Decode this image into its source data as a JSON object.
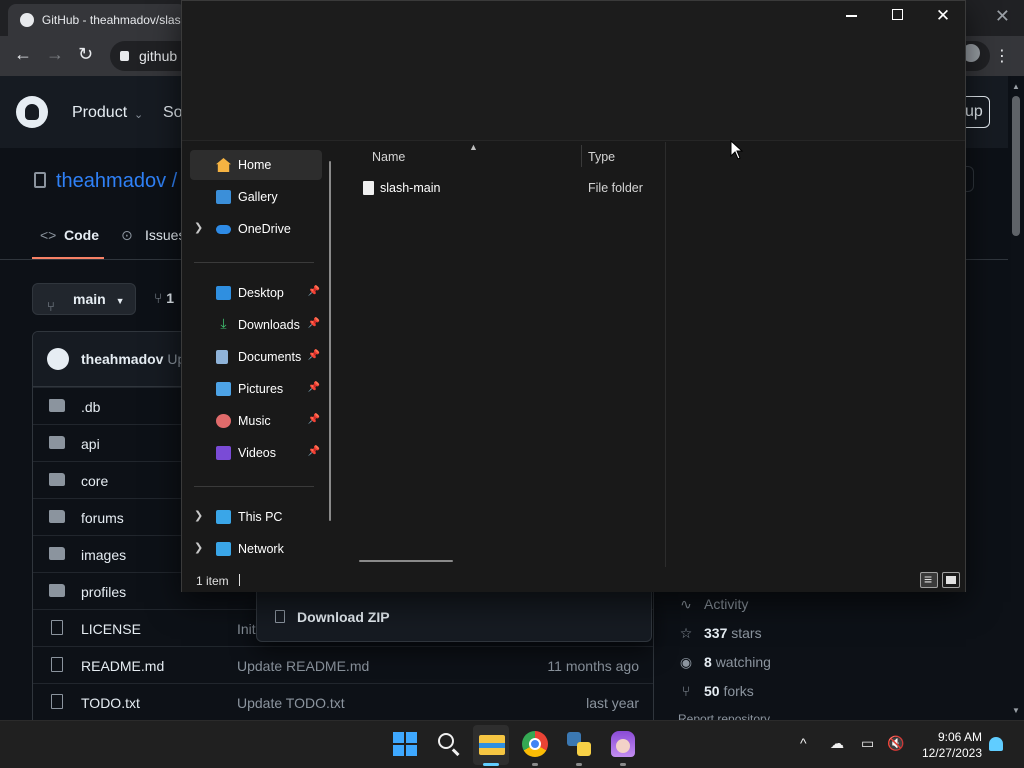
{
  "browser": {
    "tab_title": "GitHub - theahmadov/slash",
    "url_fragment": "github",
    "close_glyph": "✕",
    "menu_glyph": "⋮"
  },
  "github": {
    "nav": [
      "Product",
      "So"
    ],
    "signup_fragment": "up",
    "repo_owner": "theahmadov /",
    "tabs": [
      "Code",
      "Issues"
    ],
    "branch": "main",
    "branch_count_fragment": "1",
    "commit_author": "theahmadov",
    "commit_message_fragment": "Up",
    "files": [
      {
        "type": "folder",
        "name": ".db",
        "message": "",
        "date": ""
      },
      {
        "type": "folder",
        "name": "api",
        "message": "",
        "date": ""
      },
      {
        "type": "folder",
        "name": "core",
        "message": "",
        "date": ""
      },
      {
        "type": "folder",
        "name": "forums",
        "message": "",
        "date": ""
      },
      {
        "type": "folder",
        "name": "images",
        "message": "",
        "date": ""
      },
      {
        "type": "folder",
        "name": "profiles",
        "message": "",
        "date": ""
      },
      {
        "type": "file",
        "name": "LICENSE",
        "message": "Init",
        "date": ""
      },
      {
        "type": "file",
        "name": "README.md",
        "message": "Update README.md",
        "date": "11 months ago"
      },
      {
        "type": "file",
        "name": "TODO.txt",
        "message": "Update TODO.txt",
        "date": "last year"
      }
    ],
    "download_zip": "Download ZIP",
    "about": {
      "activity": "Activity",
      "stars_count": "337",
      "stars_label": "stars",
      "watching_count": "8",
      "watching_label": "watching",
      "forks_count": "50",
      "forks_label": "forks",
      "report_fragment": "Report repository"
    }
  },
  "explorer": {
    "nav_items": [
      {
        "label": "Home",
        "icon": "home-icon",
        "selected": true,
        "chevron": false,
        "pin": false
      },
      {
        "label": "Gallery",
        "icon": "gallery-icon",
        "selected": false,
        "chevron": false,
        "pin": false
      },
      {
        "label": "OneDrive",
        "icon": "onedrive-icon",
        "selected": false,
        "chevron": true,
        "pin": false
      },
      {
        "label": "Desktop",
        "icon": "desktop-icon",
        "selected": false,
        "chevron": false,
        "pin": true
      },
      {
        "label": "Downloads",
        "icon": "downloads-icon",
        "selected": false,
        "chevron": false,
        "pin": true
      },
      {
        "label": "Documents",
        "icon": "documents-icon",
        "selected": false,
        "chevron": false,
        "pin": true
      },
      {
        "label": "Pictures",
        "icon": "pictures-icon",
        "selected": false,
        "chevron": false,
        "pin": true
      },
      {
        "label": "Music",
        "icon": "music-icon",
        "selected": false,
        "chevron": false,
        "pin": true
      },
      {
        "label": "Videos",
        "icon": "videos-icon",
        "selected": false,
        "chevron": false,
        "pin": true
      },
      {
        "label": "This PC",
        "icon": "this-pc-icon",
        "selected": false,
        "chevron": true,
        "pin": false
      },
      {
        "label": "Network",
        "icon": "network-icon",
        "selected": false,
        "chevron": true,
        "pin": false
      }
    ],
    "columns": {
      "name": "Name",
      "type": "Type"
    },
    "items": [
      {
        "name": "slash-main",
        "type": "File folder"
      }
    ],
    "status_count": "1 item",
    "window_controls": {
      "minimize": "minimize",
      "maximize": "maximize",
      "close": "✕"
    }
  },
  "taskbar": {
    "time": "9:06 AM",
    "date": "12/27/2023",
    "tray_chevron": "^",
    "colors": {
      "accent": "#60cdff"
    }
  }
}
